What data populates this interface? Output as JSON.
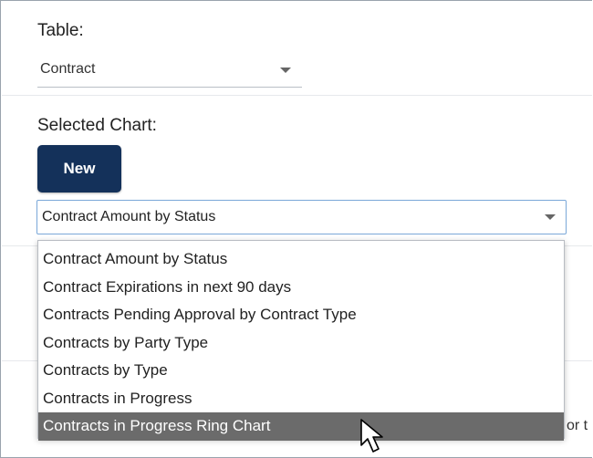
{
  "table_section": {
    "label": "Table:",
    "selected_value": "Contract"
  },
  "chart_section": {
    "label": "Selected Chart:",
    "new_button_label": "New",
    "selected_value": "Contract Amount by Status",
    "options": [
      "Contract Amount by Status",
      "Contract Expirations in next 90 days",
      "Contracts Pending Approval by Contract Type",
      "Contracts by Party Type",
      "Contracts by Type",
      "Contracts in Progress",
      "Contracts in Progress Ring Chart"
    ],
    "highlighted_option_index": 6
  },
  "background_partial_text": "or t",
  "colors": {
    "new_button_bg": "#14315a",
    "highlight_bg": "#6b6b6b",
    "select_border": "#7aa7d8"
  }
}
